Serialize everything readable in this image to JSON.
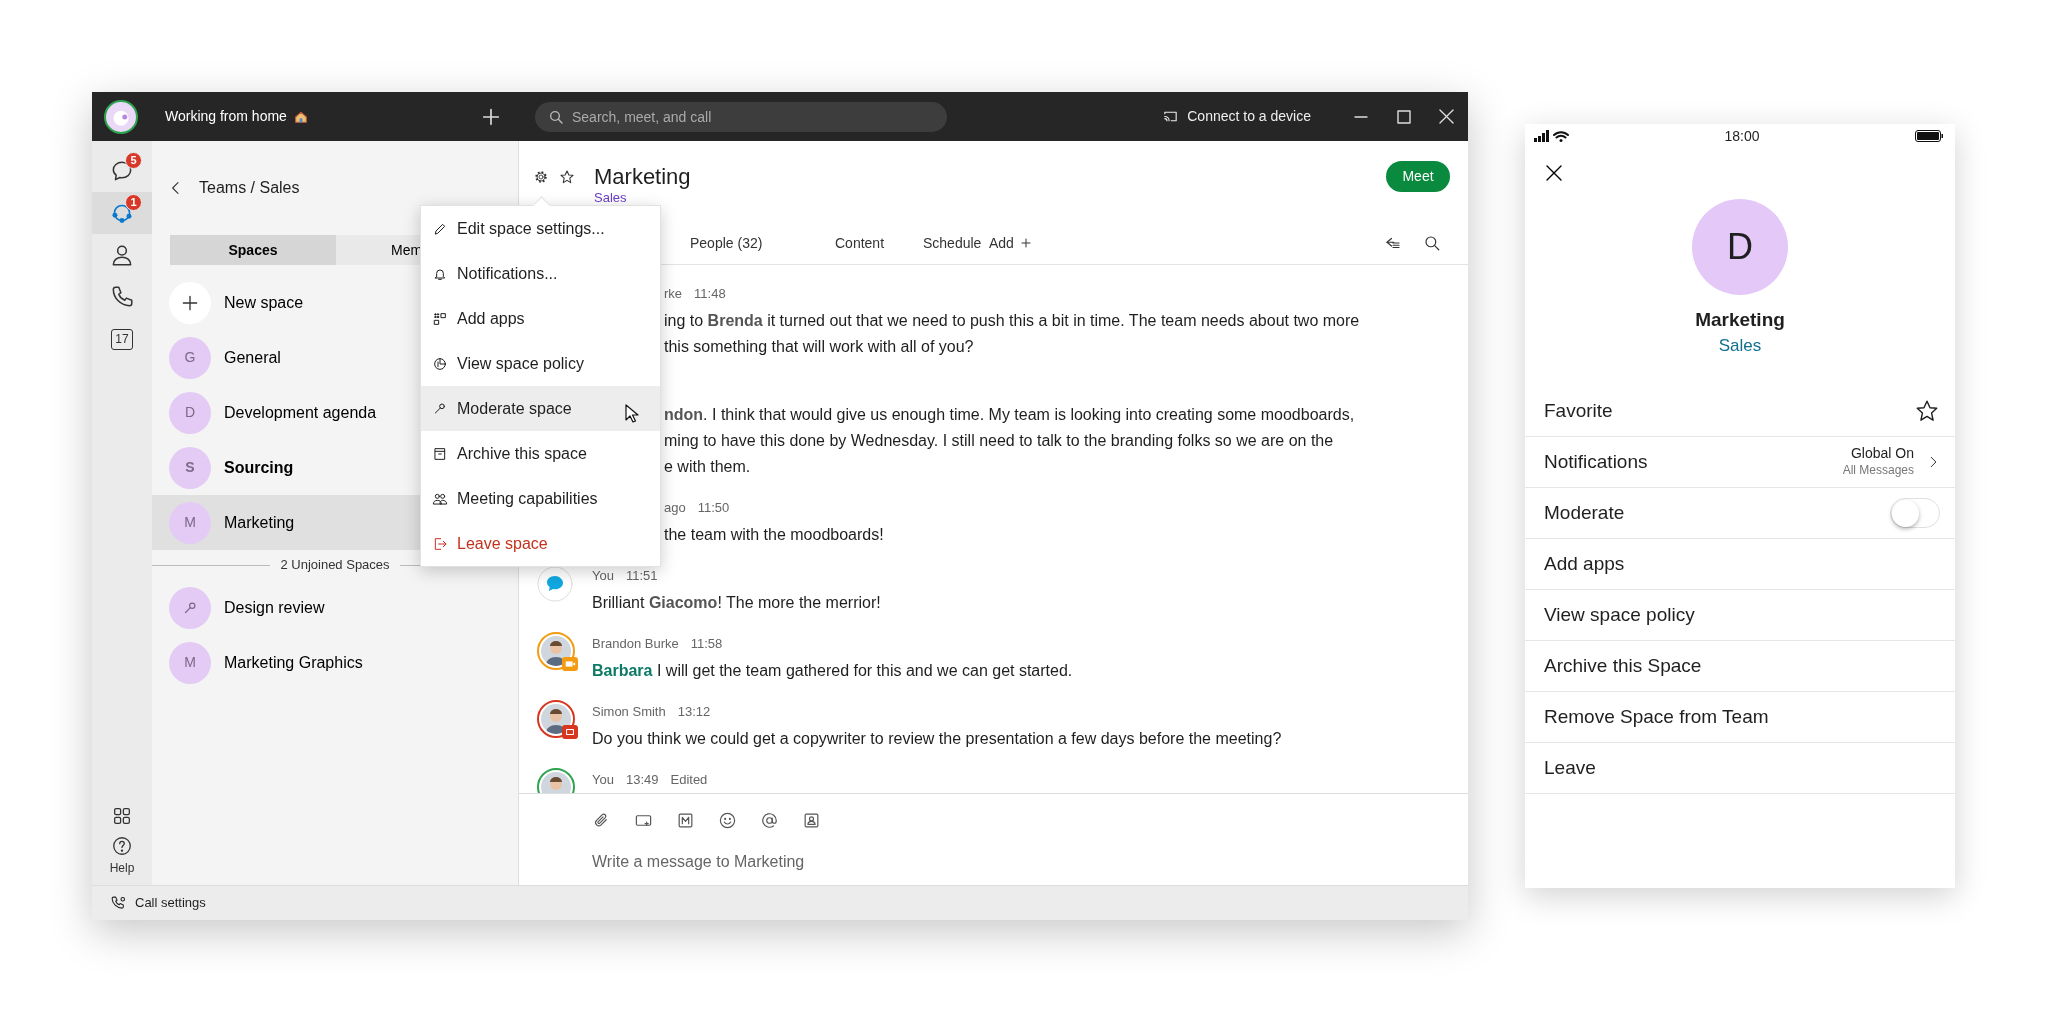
{
  "titlebar": {
    "status": "Working from home",
    "search": {
      "placeholder": "Search, meet, and call"
    },
    "connect": "Connect to a device"
  },
  "rail": {
    "items": [
      {
        "kind": "chat",
        "badge": "5",
        "selected": false
      },
      {
        "kind": "teams",
        "badge": "1",
        "selected": true
      },
      {
        "kind": "contacts",
        "selected": false
      },
      {
        "kind": "calls",
        "selected": false
      },
      {
        "kind": "calendar",
        "label": "17",
        "selected": false
      }
    ],
    "bottom": [
      {
        "kind": "apps"
      },
      {
        "kind": "help",
        "label": "Help"
      }
    ]
  },
  "spaces_panel": {
    "breadcrumb": "Teams / Sales",
    "tabs": [
      {
        "label": "Spaces",
        "selected": true
      },
      {
        "label": "Mem",
        "selected": false
      }
    ],
    "new_space": "New space",
    "spaces": [
      {
        "initial": "G",
        "name": "General",
        "unread": false,
        "selected": false
      },
      {
        "initial": "D",
        "name": "Development agenda",
        "unread": false,
        "selected": false
      },
      {
        "initial": "S",
        "name": "Sourcing",
        "unread": true,
        "selected": false
      },
      {
        "initial": "M",
        "name": "Marketing",
        "unread": false,
        "selected": true
      }
    ],
    "unjoined_label": "2 Unjoined Spaces",
    "unjoined": [
      {
        "kind": "icon",
        "name": "Design review"
      },
      {
        "kind": "initial",
        "initial": "M",
        "name": "Marketing Graphics"
      }
    ]
  },
  "chat": {
    "title": "Marketing",
    "subtitle": "Sales",
    "favorite": false,
    "meet": "Meet",
    "tabs": [
      {
        "label": "People (32)",
        "kind": "text",
        "selected": false
      },
      {
        "label": "Content",
        "kind": "text",
        "selected": false
      },
      {
        "label": "Schedule",
        "kind": "text",
        "selected": false
      },
      {
        "label": "Add",
        "kind": "add",
        "selected": false
      }
    ],
    "messages": [
      {
        "kind": "cut",
        "sender": "rke",
        "time": "11:48",
        "lines": [
          "ing to **Brenda** it turned out that we need to push this a bit in time. The team needs about two more",
          "this something that will work with all of you?"
        ],
        "mention_self": false
      },
      {
        "kind": "cut",
        "lines": [
          "**ndon**. I think that would give us enough time. My team is looking into creating some moodboards,",
          "ming to have this done by Wednesday. I still need to talk to the branding folks so we are on the",
          "e with them."
        ],
        "mention_self": false
      },
      {
        "kind": "cut",
        "sender": "ago",
        "time": "11:50",
        "lines": [
          "the team with the moodboards!"
        ]
      },
      {
        "kind": "bot",
        "sender": "You",
        "time": "11:51",
        "text": "Brilliant **Giacomo**! The more the merrior!",
        "mention_self": false
      },
      {
        "color": "#f39c12",
        "badge": {
          "kind": "video"
        },
        "sender": "Brandon Burke",
        "time": "11:58",
        "text": "**Barbara** I will get the team gathered for this and we can get started.",
        "mention_self": true
      },
      {
        "color": "#d9361f",
        "badge": {
          "kind": "share"
        },
        "sender": "Simon Smith",
        "time": "13:12",
        "text": "Do you think we could get a copywriter to review the presentation a few days before the meeting?"
      },
      {
        "color": "#2ea44f",
        "sender": "You",
        "time": "13:49",
        "edited": "Edited"
      }
    ],
    "composer": {
      "placeholder": "Write a message to Marketing"
    }
  },
  "menu": {
    "items": [
      {
        "kind": "pencil",
        "label": "Edit space settings...",
        "highlighted": false,
        "danger": false
      },
      {
        "kind": "bell",
        "label": "Notifications...",
        "highlighted": false,
        "danger": false
      },
      {
        "kind": "apps",
        "label": "Add apps",
        "highlighted": false,
        "danger": false
      },
      {
        "kind": "policy",
        "label": "View space policy",
        "highlighted": false,
        "danger": false
      },
      {
        "kind": "moderate",
        "label": "Moderate space",
        "highlighted": true,
        "danger": false
      },
      {
        "kind": "archive",
        "label": "Archive this space",
        "highlighted": false,
        "danger": false
      },
      {
        "kind": "people",
        "label": "Meeting capabilities",
        "highlighted": false,
        "danger": false
      },
      {
        "kind": "leave",
        "label": "Leave space",
        "highlighted": false,
        "danger": true
      }
    ]
  },
  "footer": {
    "call_settings": "Call settings"
  },
  "phone": {
    "time": "18:00",
    "avatar": "D",
    "title": "Marketing",
    "subtitle": "Sales",
    "rows": [
      {
        "kind": "star",
        "label": "Favorite",
        "on": false
      },
      {
        "kind": "detail",
        "label": "Notifications",
        "value": "Global On",
        "note": "All Messages"
      },
      {
        "kind": "toggle",
        "label": "Moderate",
        "on": false
      },
      {
        "kind": "plain",
        "label": "Add apps"
      },
      {
        "kind": "plain",
        "label": "View space policy"
      },
      {
        "kind": "plain",
        "label": "Archive this Space"
      },
      {
        "kind": "plain",
        "label": "Remove Space from Team"
      },
      {
        "kind": "plain",
        "label": "Leave"
      }
    ]
  }
}
